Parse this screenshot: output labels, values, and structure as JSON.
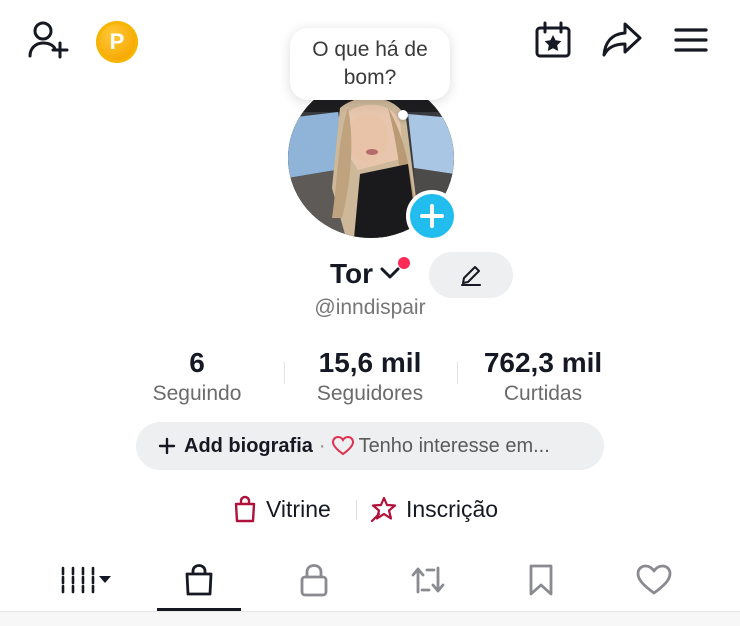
{
  "header": {
    "icons": [
      "add-friend-icon",
      "coin-icon",
      "calendar-star-icon",
      "share-icon",
      "menu-icon"
    ],
    "coin_letter": "P"
  },
  "bubble": {
    "text": "O que há de bom?"
  },
  "profile": {
    "name": "Tor",
    "handle": "@inndispair"
  },
  "stats": [
    {
      "value": "6",
      "label": "Seguindo"
    },
    {
      "value": "15,6 mil",
      "label": "Seguidores"
    },
    {
      "value": "762,3 mil",
      "label": "Curtidas"
    }
  ],
  "bio": {
    "add_label": "Add biografia",
    "separator": "·",
    "interest_label": "Tenho interesse em..."
  },
  "shop": {
    "vitrine_label": "Vitrine",
    "inscricao_label": "Inscrição"
  },
  "tabs": {
    "icons": [
      "grid-filter-icon",
      "shopping-bag-icon",
      "lock-icon",
      "repost-icon",
      "bookmark-icon",
      "heart-icon"
    ],
    "active_index": 1
  },
  "colors": {
    "accent_red": "#fe2c55",
    "plus_blue": "#20bdee",
    "coin_gold": "#f7a700",
    "shop_crimson": "#b0113a"
  }
}
